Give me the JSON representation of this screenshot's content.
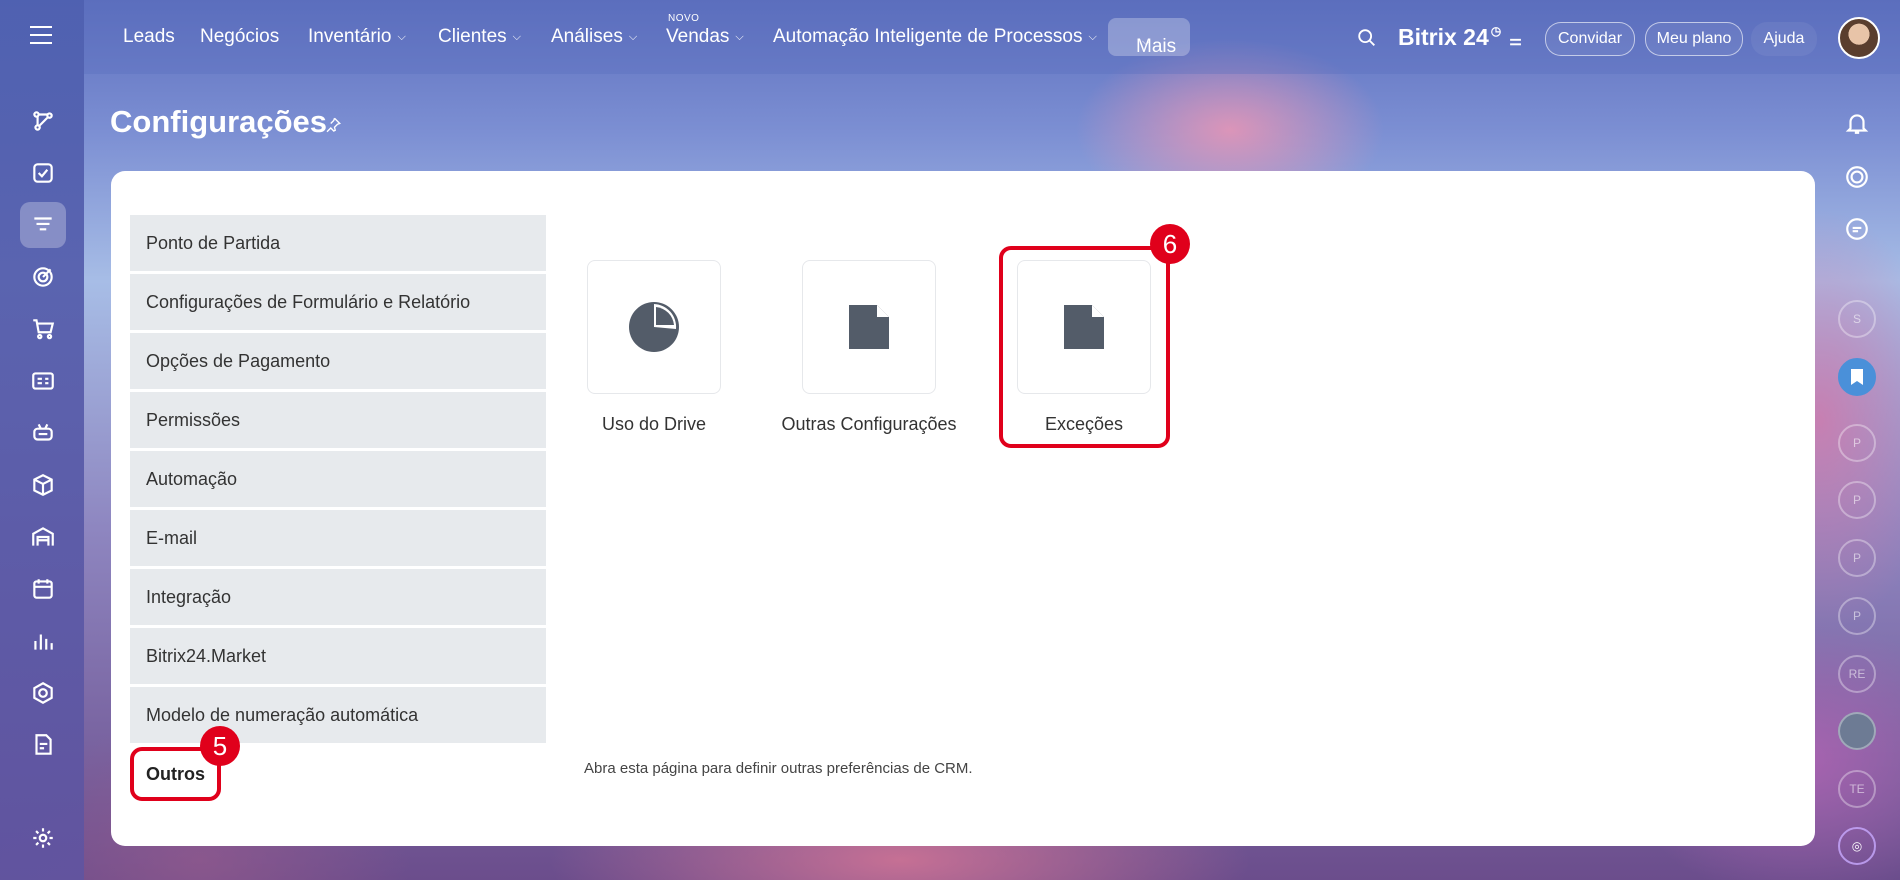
{
  "topnav": {
    "items": [
      {
        "label": "Leads",
        "dropdown": false
      },
      {
        "label": "Negócios",
        "dropdown": false
      },
      {
        "label": "Inventário",
        "dropdown": true
      },
      {
        "label": "Clientes",
        "dropdown": true
      },
      {
        "label": "Análises",
        "dropdown": true
      },
      {
        "label": "Vendas",
        "dropdown": true
      },
      {
        "label": "Automação Inteligente de Processos",
        "dropdown": true
      }
    ],
    "badge_new": "NOVO",
    "more_label": "Mais",
    "brand": "Bitrix 24",
    "invite_label": "Convidar",
    "plan_label": "Meu plano",
    "help_label": "Ajuda"
  },
  "page": {
    "title": "Configurações"
  },
  "settings_menu": {
    "items": [
      "Ponto de Partida",
      "Configurações de Formulário e Relatório",
      "Opções de Pagamento",
      "Permissões",
      "Automação",
      "E-mail",
      "Integração",
      "Bitrix24.Market",
      "Modelo de numeração automática",
      "Outros"
    ],
    "selected": "Outros"
  },
  "tiles": [
    {
      "label": "Uso do Drive",
      "icon": "pie-chart-icon"
    },
    {
      "label": "Outras Configurações",
      "icon": "document-icon"
    },
    {
      "label": "Exceções",
      "icon": "document-icon"
    }
  ],
  "description": "Abra esta página para definir outras preferências de CRM.",
  "annotations": {
    "step5": "5",
    "step6": "6",
    "highlight_color": "#e0001b"
  },
  "rightbar": {
    "avatars": [
      "S",
      "P",
      "P",
      "P",
      "P",
      "RE",
      "TE"
    ]
  }
}
